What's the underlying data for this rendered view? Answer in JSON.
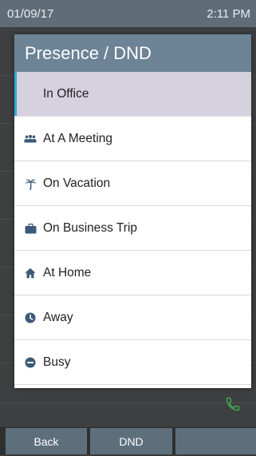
{
  "status_bar": {
    "date": "01/09/17",
    "time": "2:11 PM"
  },
  "dialog": {
    "title": "Presence / DND",
    "items": [
      {
        "label": "In Office",
        "icon": "none",
        "selected": true
      },
      {
        "label": "At A Meeting",
        "icon": "people-icon",
        "selected": false
      },
      {
        "label": "On Vacation",
        "icon": "palm-tree-icon",
        "selected": false
      },
      {
        "label": "On Business Trip",
        "icon": "briefcase-icon",
        "selected": false
      },
      {
        "label": "At Home",
        "icon": "home-icon",
        "selected": false
      },
      {
        "label": "Away",
        "icon": "clock-icon",
        "selected": false
      },
      {
        "label": "Busy",
        "icon": "minus-circle-icon",
        "selected": false
      }
    ]
  },
  "softkeys": {
    "back": "Back",
    "dnd": "DND",
    "third": ""
  },
  "colors": {
    "title_bar": "#6d8396",
    "selected_row": "#d5d1de",
    "selected_accent": "#2fa9e0",
    "softkey": "#5e6f7c",
    "phone_icon": "#3f9b53"
  }
}
